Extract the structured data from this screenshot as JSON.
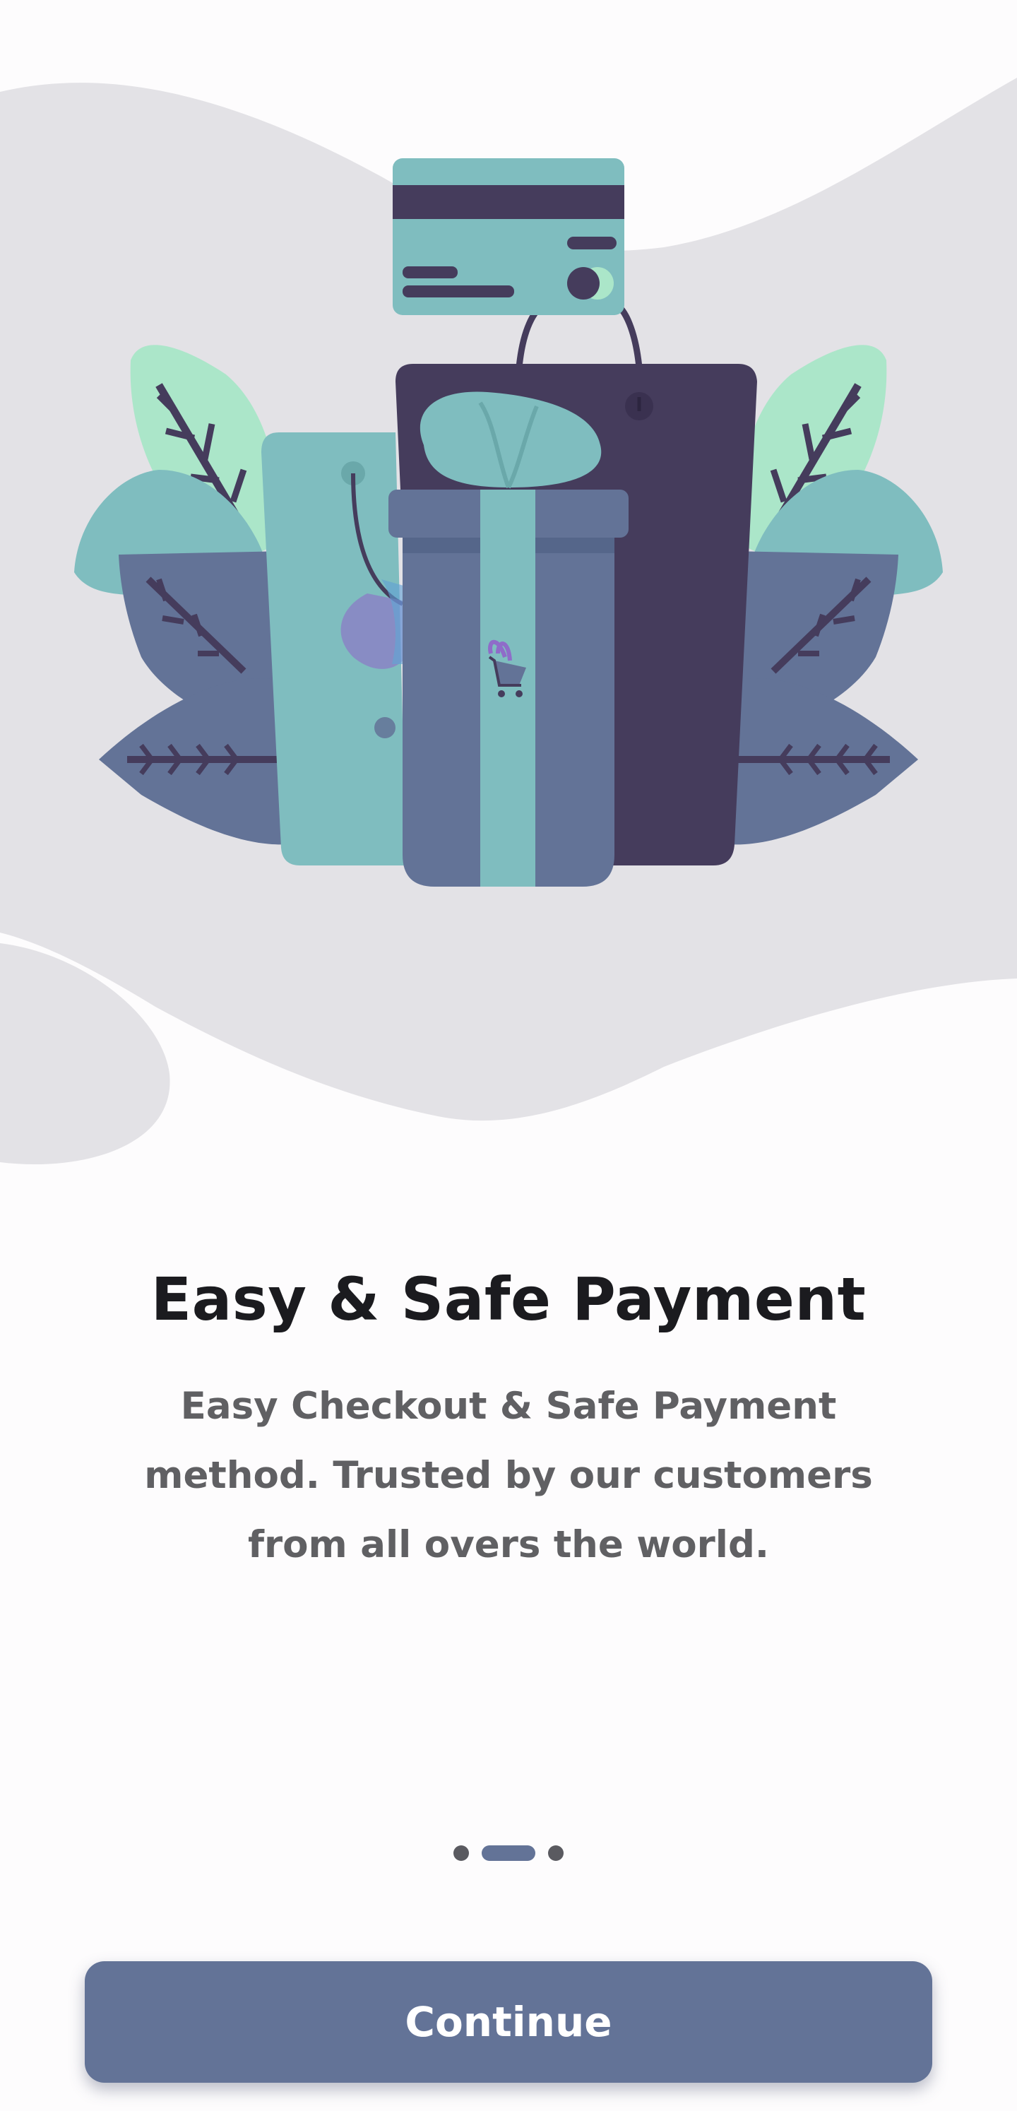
{
  "onboarding": {
    "title": "Easy & Safe Payment",
    "subtitle": "Easy Checkout & Safe Payment method. Trusted by our customers from all overs the world.",
    "continue_label": "Continue",
    "pagination": {
      "total": 3,
      "active_index": 1
    },
    "illustration": {
      "name": "shopping-bags-gift-credit-card-illustration",
      "icons": [
        "credit-card-icon",
        "shopping-bag-icon",
        "gift-box-icon",
        "shopping-cart-icon",
        "leaf-icon"
      ]
    }
  },
  "colors": {
    "background": "#fdfcfd",
    "blob": "#e3e2e6",
    "accent": "#637397",
    "teal": "#7fbdbf",
    "dark_purple": "#453c5c",
    "mint": "#abe6c9",
    "title_text": "#1b1b1f",
    "body_text": "#606063",
    "dot_inactive": "#5a5a60"
  }
}
